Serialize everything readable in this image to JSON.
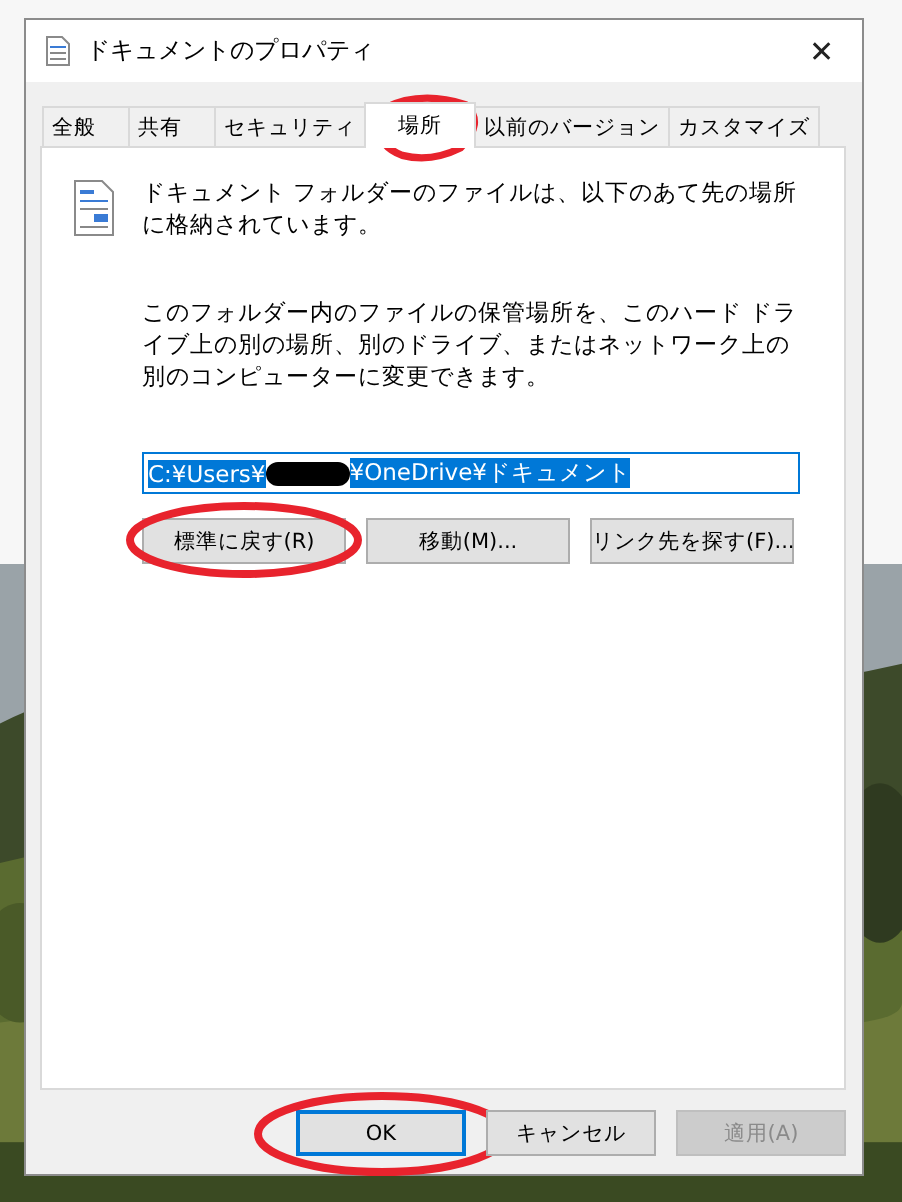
{
  "window": {
    "title": "ドキュメントのプロパティ",
    "close": "✕"
  },
  "tabs": [
    {
      "label": "全般",
      "selected": false
    },
    {
      "label": "共有",
      "selected": false
    },
    {
      "label": "セキュリティ",
      "selected": false
    },
    {
      "label": "場所",
      "selected": true
    },
    {
      "label": "以前のバージョン",
      "selected": false
    },
    {
      "label": "カスタマイズ",
      "selected": false
    }
  ],
  "description": "ドキュメント フォルダーのファイルは、以下のあて先の場所に格納されています。",
  "instructions": "このフォルダー内のファイルの保管場所を、このハード ドライブ上の別の場所、別のドライブ、またはネットワーク上の別のコンピューターに変更できます。",
  "path": {
    "prefix": "C:¥Users¥",
    "suffix": "¥OneDrive¥ドキュメント",
    "selected": true
  },
  "location_buttons": [
    {
      "label": "標準に戻す(R)",
      "circled": true
    },
    {
      "label": "移動(M)...",
      "circled": false
    },
    {
      "label": "リンク先を探す(F)...",
      "circled": false
    }
  ],
  "buttons": [
    {
      "label": "OK",
      "focused": true,
      "disabled": false,
      "circled": true
    },
    {
      "label": "キャンセル",
      "focused": false,
      "disabled": false,
      "circled": false
    },
    {
      "label": "適用(A)",
      "focused": false,
      "disabled": true,
      "circled": false
    }
  ]
}
